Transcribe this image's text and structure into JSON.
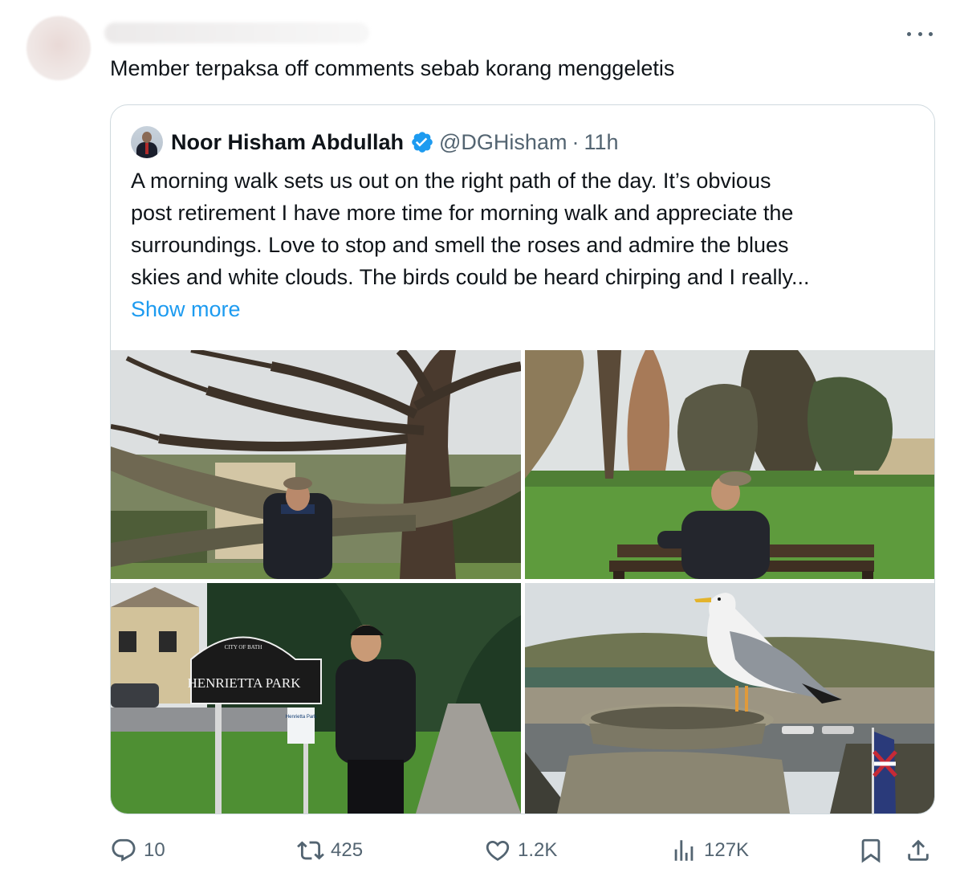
{
  "post": {
    "text": "Member terpaksa off comments sebab korang menggeletis"
  },
  "quoted": {
    "author_name": "Noor Hisham Abdullah",
    "handle": "@DGHisham",
    "separator": "·",
    "time": "11h",
    "lines": [
      "A morning walk sets us out on the right path of the day. It’s obvious",
      "post retirement I have more time for morning walk and appreciate the",
      "surroundings. Love to stop and smell the roses and admire the blues",
      "skies and white clouds. The birds could be heard chirping and I really..."
    ],
    "show_more": "Show more",
    "sign_text": "HENRIETTA PARK",
    "sign_arc": "CITY OF BATH",
    "small_sign": "Henrietta Park"
  },
  "actions": {
    "replies": "10",
    "reposts": "425",
    "likes": "1.2K",
    "views": "127K"
  },
  "icons": [
    "more-icon",
    "verified-badge-icon",
    "reply-icon",
    "repost-icon",
    "like-icon",
    "views-icon",
    "bookmark-icon",
    "share-icon"
  ],
  "colors": {
    "link": "#1d9bf0",
    "muted": "#536471",
    "border": "#cfd9de"
  }
}
